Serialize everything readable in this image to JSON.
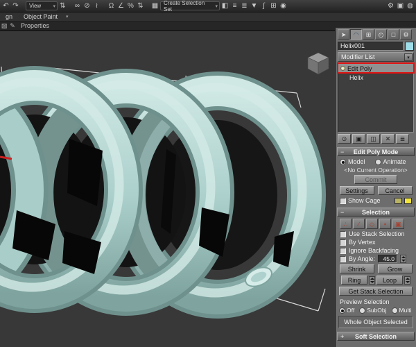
{
  "ui": {
    "chevron_down": "▾"
  },
  "colors": {
    "annotation_red": "#e21212",
    "object_teal": "#aed1cd",
    "viewport_background": "#383838",
    "object_color_swatch": "#9fdde8",
    "cage_color_a": "#b9b463",
    "cage_color_b": "#f2e43a"
  },
  "toolbar": {
    "view_combo": "View",
    "selection_set_combo": "Create Selection Set",
    "icons": [
      {
        "name": "undo-icon",
        "glyph": "↶"
      },
      {
        "name": "redo-icon",
        "glyph": "↷"
      },
      {
        "name": "spinner-arrows-icon",
        "glyph": "⇅"
      },
      {
        "name": "select-and-link-icon",
        "glyph": "∞"
      },
      {
        "name": "unlink-selection-icon",
        "glyph": "⊘"
      },
      {
        "name": "bind-to-space-warp-icon",
        "glyph": "≀"
      },
      {
        "name": "snaps-toggle-icon",
        "glyph": "Ω"
      },
      {
        "name": "angle-snap-icon",
        "glyph": "∠"
      },
      {
        "name": "percent-snap-icon",
        "glyph": "%"
      },
      {
        "name": "spinner-snap-icon",
        "glyph": "⇅"
      },
      {
        "name": "edit-named-selection-sets-icon",
        "glyph": "▦"
      },
      {
        "name": "mirror-icon",
        "glyph": "◧"
      },
      {
        "name": "align-icon",
        "glyph": "≡"
      },
      {
        "name": "layer-manager-icon",
        "glyph": "≣"
      },
      {
        "name": "ribbon-toggle-icon",
        "glyph": "▼"
      },
      {
        "name": "curve-editor-icon",
        "glyph": "∫"
      },
      {
        "name": "schematic-view-icon",
        "glyph": "⊞"
      },
      {
        "name": "material-editor-icon",
        "glyph": "◉"
      },
      {
        "name": "render-setup-icon",
        "glyph": "⚙"
      },
      {
        "name": "rendered-frame-icon",
        "glyph": "▣"
      },
      {
        "name": "render-production-icon",
        "glyph": "◍"
      }
    ]
  },
  "ribbon": {
    "tab_partial": "gn",
    "tab_object_paint": "Object Paint",
    "properties_label": "Properties",
    "tool_icons": [
      {
        "name": "ribbon-panel-icon",
        "glyph": "▨"
      },
      {
        "name": "paint-tool-icon",
        "glyph": "✎"
      }
    ]
  },
  "command_panel": {
    "tabs": [
      {
        "name": "create",
        "glyph": "➤"
      },
      {
        "name": "modify",
        "glyph": "◠"
      },
      {
        "name": "hierarchy",
        "glyph": "⊞"
      },
      {
        "name": "motion",
        "glyph": "◴"
      },
      {
        "name": "display",
        "glyph": "□"
      },
      {
        "name": "utilities",
        "glyph": "⚙"
      }
    ],
    "object_name": "Helix001",
    "modifier_list_label": "Modifier List",
    "stack": [
      {
        "label": "Edit Poly"
      },
      {
        "label": "Helix"
      }
    ],
    "stack_buttons": [
      {
        "name": "pin-stack",
        "glyph": "⊙"
      },
      {
        "name": "show-end-result",
        "glyph": "▣"
      },
      {
        "name": "make-unique",
        "glyph": "◫"
      },
      {
        "name": "remove-modifier",
        "glyph": "✕"
      },
      {
        "name": "configure-modifier-sets",
        "glyph": "≣"
      }
    ],
    "edit_poly_mode": {
      "title": "Edit Poly Mode",
      "collapse_glyph": "−",
      "model_label": "Model",
      "animate_label": "Animate",
      "operation_text": "<No Current Operation>",
      "commit_label": "Commit",
      "settings_label": "Settings",
      "cancel_label": "Cancel",
      "show_cage_label": "Show Cage"
    },
    "selection": {
      "title": "Selection",
      "collapse_glyph": "−",
      "subobject_icons": [
        {
          "name": "vertex",
          "glyph": "∴"
        },
        {
          "name": "edge",
          "glyph": "∕"
        },
        {
          "name": "border",
          "glyph": "◇"
        },
        {
          "name": "polygon",
          "glyph": "▪"
        },
        {
          "name": "element",
          "glyph": "▣"
        }
      ],
      "use_stack_selection_label": "Use Stack Selection",
      "by_vertex_label": "By Vertex",
      "ignore_backfacing_label": "Ignore Backfacing",
      "by_angle_label": "By Angle:",
      "by_angle_value": "45.0",
      "shrink_label": "Shrink",
      "grow_label": "Grow",
      "ring_label": "Ring",
      "loop_label": "Loop",
      "get_stack_selection_label": "Get Stack Selection",
      "preview_selection_label": "Preview Selection",
      "preview_off_label": "Off",
      "preview_subobj_label": "SubObj",
      "preview_multi_label": "Multi",
      "status_text": "Whole Object Selected"
    },
    "soft_selection": {
      "title": "Soft Selection",
      "collapse_glyph": "+"
    }
  }
}
